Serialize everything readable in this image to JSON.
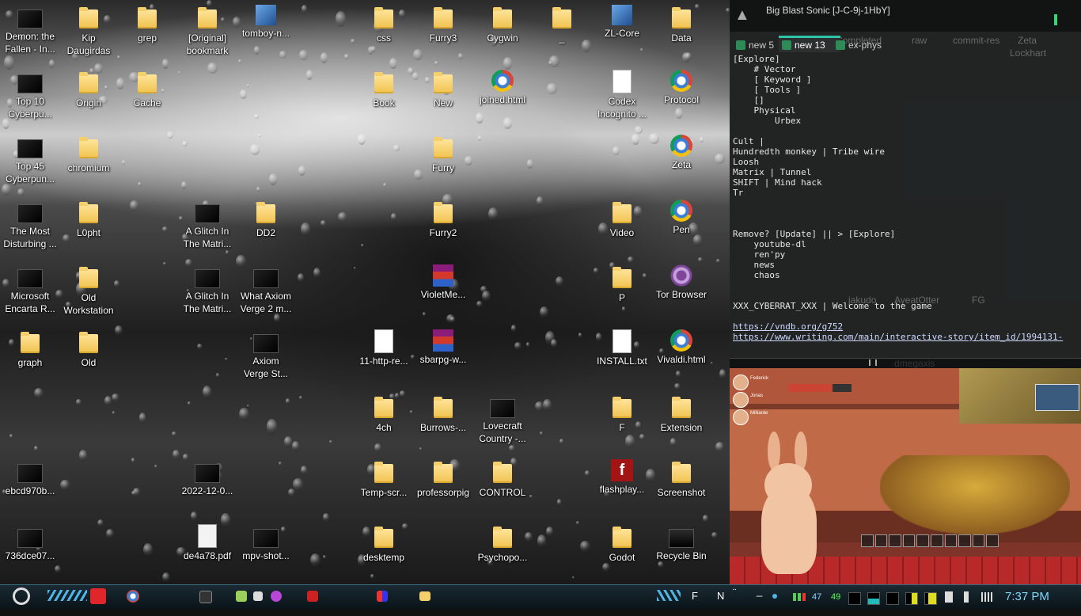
{
  "desktop": {
    "icons": [
      {
        "label": "Demon: the\nFallen - In...",
        "type": "video"
      },
      {
        "label": "Kip\nDaugirdas",
        "type": "folder"
      },
      {
        "label": "grep",
        "type": "folder"
      },
      {
        "label": "[Original]\nbookmark",
        "type": "folder"
      },
      {
        "label": "tomboy-n...",
        "type": "app"
      },
      {
        "label": "css",
        "type": "folder"
      },
      {
        "label": "Furry3",
        "type": "folder"
      },
      {
        "label": "Cygwin",
        "type": "folder"
      },
      {
        "label": "_",
        "type": "folder"
      },
      {
        "label": "ZL-Core",
        "type": "app"
      },
      {
        "label": "Data",
        "type": "folder"
      },
      {
        "label": "Top 10\nCyberpu...",
        "type": "video"
      },
      {
        "label": "Origin",
        "type": "folder"
      },
      {
        "label": "Cache",
        "type": "folder"
      },
      {
        "label": "Book",
        "type": "folder"
      },
      {
        "label": "New",
        "type": "folder"
      },
      {
        "label": "joined.html",
        "type": "chrome"
      },
      {
        "label": "Codex\nIncognito ...",
        "type": "doc"
      },
      {
        "label": "Protocol",
        "type": "chrome"
      },
      {
        "label": "Top 45\nCyberpun...",
        "type": "video"
      },
      {
        "label": "chromium",
        "type": "folder"
      },
      {
        "label": "Furry",
        "type": "folder"
      },
      {
        "label": "Zeta",
        "type": "chrome"
      },
      {
        "label": "The Most\nDisturbing ...",
        "type": "video"
      },
      {
        "label": "L0pht",
        "type": "folder"
      },
      {
        "label": "A Glitch In\nThe Matri...",
        "type": "video"
      },
      {
        "label": "DD2",
        "type": "folder"
      },
      {
        "label": "Furry2",
        "type": "folder"
      },
      {
        "label": "Video",
        "type": "folder"
      },
      {
        "label": "Pen",
        "type": "chrome"
      },
      {
        "label": "Microsoft\nEncarta R...",
        "type": "video"
      },
      {
        "label": "Old\nWorkstation",
        "type": "folder"
      },
      {
        "label": "A Glitch In\nThe Matri...",
        "type": "video"
      },
      {
        "label": "What Axiom\nVerge 2 m...",
        "type": "video"
      },
      {
        "label": "VioletMe...",
        "type": "rar"
      },
      {
        "label": "P",
        "type": "folder"
      },
      {
        "label": "Tor Browser",
        "type": "tor"
      },
      {
        "label": "graph",
        "type": "folder"
      },
      {
        "label": "Old",
        "type": "folder"
      },
      {
        "label": "Axiom\nVerge St...",
        "type": "video"
      },
      {
        "label": "11-http-re...",
        "type": "doc"
      },
      {
        "label": "sbarpg-w...",
        "type": "rar"
      },
      {
        "label": "INSTALL.txt",
        "type": "doc"
      },
      {
        "label": "Vivaldi.html",
        "type": "chrome"
      },
      {
        "label": "4ch",
        "type": "folder"
      },
      {
        "label": "Burrows-...",
        "type": "folder"
      },
      {
        "label": "Lovecraft\nCountry -...",
        "type": "video"
      },
      {
        "label": "F",
        "type": "folder"
      },
      {
        "label": "Extension",
        "type": "folder"
      },
      {
        "label": "ebcd970b...",
        "type": "video"
      },
      {
        "label": "2022-12-0...",
        "type": "video"
      },
      {
        "label": "Temp-scr...",
        "type": "folder"
      },
      {
        "label": "professorpig",
        "type": "folder"
      },
      {
        "label": "CONTROL",
        "type": "folder"
      },
      {
        "label": "flashplay...",
        "type": "flash"
      },
      {
        "label": "Screenshot",
        "type": "folder"
      },
      {
        "label": "736dce07...",
        "type": "video"
      },
      {
        "label": "de4a78.pdf",
        "type": "pdf"
      },
      {
        "label": "mpv-shot...",
        "type": "video"
      },
      {
        "label": "desktemp",
        "type": "folder"
      },
      {
        "label": "Psychopo...",
        "type": "folder"
      },
      {
        "label": "Godot",
        "type": "folder"
      },
      {
        "label": "Recycle Bin",
        "type": "bin"
      }
    ]
  },
  "notepad": {
    "title": "Big Blast Sonic [J-C-9j-1HbY]",
    "tabs": [
      "new 5",
      "new 13",
      "ex-phys"
    ],
    "ghost_labels": [
      "Completed",
      "raw",
      "commit-res",
      "Zeta",
      "Lockhart",
      "jakudo",
      "AyeatOtter",
      "FG",
      "dmegaxis"
    ],
    "lines": [
      "[Explore]",
      "    # Vector",
      "    [ Keyword ]",
      "    [ Tools ]",
      "    []",
      "    Physical",
      "        Urbex",
      "",
      "Cult |",
      "Hundredth monkey | Tribe wire",
      "Loosh",
      "Matrix | Tunnel",
      "SHIFT | Mind hack",
      "Tr",
      "",
      "",
      "",
      "Remove? [Update] || > [Explore]",
      "    youtube-dl",
      "    ren'py",
      "    news",
      "    chaos",
      "",
      "",
      "XXX_CYBERRAT_XXX | Welcome to the game",
      "",
      "https://vndb.org/g752",
      "https://www.writing.com/main/interactive-story/item_id/1994131-"
    ]
  },
  "game": {
    "party": [
      "Federick",
      "Jonas",
      "Milliarde"
    ]
  },
  "taskbar": {
    "items": [
      "F",
      "N",
      "¨",
      "_",
      "47",
      "49"
    ],
    "clock": "7:37 PM"
  }
}
